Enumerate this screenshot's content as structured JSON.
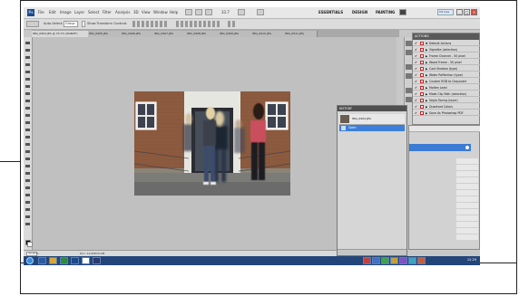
{
  "menubar": {
    "logo": "Ps",
    "menus": [
      "File",
      "Edit",
      "Image",
      "Layer",
      "Select",
      "Filter",
      "Analysis",
      "3D",
      "View",
      "Window",
      "Help"
    ],
    "zoom": "33.7",
    "workspaces": [
      "ESSENTIALS",
      "DESIGN",
      "PAINTING"
    ],
    "cslive": "CS Live"
  },
  "options_bar": {
    "auto_select": "Auto-Select:",
    "group": "Group",
    "transform_controls": "Show Transform Controls"
  },
  "tabs": [
    "IMG_0904.JPG @ 33.7% (RGB/8*)",
    "IMG_0905.JPG",
    "IMG_0906.JPG",
    "IMG_0907.JPG",
    "IMG_0908.JPG",
    "IMG_0909.JPG",
    "IMG_0910.JPG",
    "IMG_0911.JPG"
  ],
  "status": {
    "zoom": "33.67%",
    "doc": "Doc: 10.4M/10.4M"
  },
  "actions_panel": {
    "title": "ACTIONS",
    "items": [
      "Default Actions",
      "Vignette (selection)",
      "Frame Channel - 50 pixel",
      "Wood Frame - 50 pixel",
      "Cast Shadow (type)",
      "Water Reflection (type)",
      "Custom RGB to Grayscale",
      "Molten Lead",
      "Make Clip Path (selection)",
      "Sepia Toning (layer)",
      "Quadrant Colors",
      "Save As Photoshop PDF"
    ]
  },
  "history_panel": {
    "title": "HISTORY",
    "snapshot": "IMG_0904.JPG",
    "state": "Open"
  },
  "taskbar": {
    "clock": "12:29"
  },
  "colors": {
    "accent": "#3b7bd4",
    "taskbar": "#23467a"
  }
}
